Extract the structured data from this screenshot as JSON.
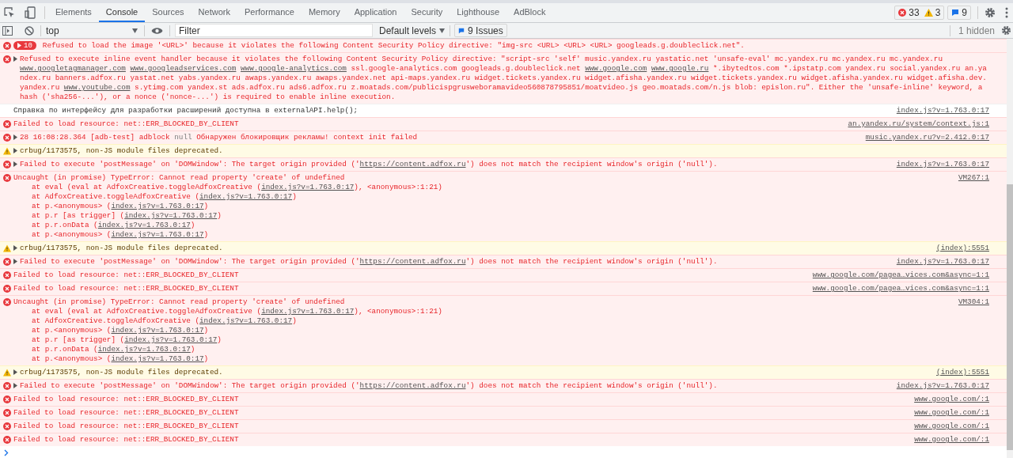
{
  "tabs": [
    {
      "label": "Elements",
      "selected": false
    },
    {
      "label": "Console",
      "selected": true
    },
    {
      "label": "Sources",
      "selected": false
    },
    {
      "label": "Network",
      "selected": false
    },
    {
      "label": "Performance",
      "selected": false
    },
    {
      "label": "Memory",
      "selected": false
    },
    {
      "label": "Application",
      "selected": false
    },
    {
      "label": "Security",
      "selected": false
    },
    {
      "label": "Lighthouse",
      "selected": false
    },
    {
      "label": "AdBlock",
      "selected": false
    }
  ],
  "counters": {
    "errors": "33",
    "warnings": "3",
    "issues": "9"
  },
  "toolbar": {
    "context": "top",
    "filter": {
      "placeholder": "Filter"
    },
    "levels": "Default levels",
    "issues_button": "9 Issues",
    "hidden": "1 hidden"
  },
  "messages": [
    {
      "kind": "error",
      "count": "10",
      "expander": false,
      "text": "Refused to load the image '<URL>' because it violates the following Content Security Policy directive: \"img-src <URL> <URL> <URL> googleads.g.doubleclick.net\"."
    },
    {
      "kind": "error",
      "expander": true,
      "parts": [
        {
          "kind": "text",
          "text": "Refused to execute inline event handler because it violates the following Content Security Policy directive: \"script-src 'self' music.yandex.ru yastatic.net 'unsafe-eval' mc.yandex.ru mc.yandex.ru mc.yandex.ru "
        },
        {
          "kind": "link",
          "text": "www.googletagmanager.com"
        },
        {
          "kind": "link",
          "text": "www.googleadservices.com"
        },
        {
          "kind": "link",
          "text": "www.google-analytics.com"
        },
        {
          "kind": "text",
          "text": " ssl.google-analytics.com googleads.g.doubleclick.net "
        },
        {
          "kind": "link",
          "text": "www.google.com"
        },
        {
          "kind": "link",
          "text": "www.google.ru"
        },
        {
          "kind": "text",
          "text": " *.ibytedtos.com *.ipstatp.com yandex.ru social.yandex.ru an.yandex.ru banners.adfox.ru yastat.net yabs.yandex.ru awaps.yandex.ru awaps.yandex.net api-maps.yandex.ru widget.tickets.yandex.ru widget.afisha.yandex.ru widget.tickets.yandex.ru widget.afisha.yandex.ru widget.afisha.dev.yandex.ru "
        },
        {
          "kind": "link",
          "text": "www.youtube.com"
        },
        {
          "kind": "text",
          "text": " s.ytimg.com yandex.st ads.adfox.ru ads6.adfox.ru z.moatads.com/publicispgrusweboramavideo560878795851/moatvideo.js geo.moatads.com/n.js blob: epislon.ru\". Either the 'unsafe-inline' keyword, a hash ('sha256-...'), or a nonce ('nonce-...') is required to enable inline execution."
        }
      ]
    },
    {
      "kind": "info",
      "expander": false,
      "text": "Справка по интерфейсу для разработки расширений доступна в externalAPI.help();",
      "source": "index.js?v=1.763.0:17"
    },
    {
      "kind": "error",
      "expander": false,
      "text": "Failed to load resource: net::ERR_BLOCKED_BY_CLIENT",
      "source": "an.yandex.ru/system/context.js:1"
    },
    {
      "kind": "error",
      "expander": true,
      "parts": [
        {
          "kind": "text",
          "text": "28 16:08:28.364 [adb-test] adblock "
        },
        {
          "kind": "muted",
          "text": "null"
        },
        {
          "kind": "text",
          "text": " Обнаружен блокировщик рекламы! context init failed"
        }
      ],
      "source": "music.yandex.ru?v=2.412.0:17"
    },
    {
      "kind": "warning",
      "expander": true,
      "text": "crbug/1173575, non-JS module files deprecated."
    },
    {
      "kind": "error",
      "expander": true,
      "parts": [
        {
          "kind": "text",
          "text": "Failed to execute 'postMessage' on 'DOMWindow': The target origin provided ('"
        },
        {
          "kind": "link",
          "text": "https://content.adfox.ru"
        },
        {
          "kind": "text",
          "text": "') does not match the recipient window's origin ('null')."
        }
      ],
      "source": "index.js?v=1.763.0:17"
    },
    {
      "kind": "error",
      "expander": false,
      "text": "Uncaught (in promise) TypeError: Cannot read property 'create' of undefined",
      "source": "VM267:1",
      "stack": [
        {
          "parts": [
            {
              "kind": "text",
              "text": "at eval (eval at AdfoxCreative.toggleAdfoxCreative ("
            },
            {
              "kind": "link",
              "text": "index.js?v=1.763.0:17"
            },
            {
              "kind": "text",
              "text": "), <anonymous>:1:21)"
            }
          ]
        },
        {
          "parts": [
            {
              "kind": "text",
              "text": "at AdfoxCreative.toggleAdfoxCreative ("
            },
            {
              "kind": "link",
              "text": "index.js?v=1.763.0:17"
            },
            {
              "kind": "text",
              "text": ")"
            }
          ]
        },
        {
          "parts": [
            {
              "kind": "text",
              "text": "at p.<anonymous> ("
            },
            {
              "kind": "link",
              "text": "index.js?v=1.763.0:17"
            },
            {
              "kind": "text",
              "text": ")"
            }
          ]
        },
        {
          "parts": [
            {
              "kind": "text",
              "text": "at p.r [as trigger] ("
            },
            {
              "kind": "link",
              "text": "index.js?v=1.763.0:17"
            },
            {
              "kind": "text",
              "text": ")"
            }
          ]
        },
        {
          "parts": [
            {
              "kind": "text",
              "text": "at p.r.onData ("
            },
            {
              "kind": "link",
              "text": "index.js?v=1.763.0:17"
            },
            {
              "kind": "text",
              "text": ")"
            }
          ]
        },
        {
          "parts": [
            {
              "kind": "text",
              "text": "at p.<anonymous> ("
            },
            {
              "kind": "link",
              "text": "index.js?v=1.763.0:17"
            },
            {
              "kind": "text",
              "text": ")"
            }
          ]
        }
      ]
    },
    {
      "kind": "warning",
      "expander": true,
      "text": "crbug/1173575, non-JS module files deprecated.",
      "source": "(index):5551"
    },
    {
      "kind": "error",
      "expander": true,
      "parts": [
        {
          "kind": "text",
          "text": "Failed to execute 'postMessage' on 'DOMWindow': The target origin provided ('"
        },
        {
          "kind": "link",
          "text": "https://content.adfox.ru"
        },
        {
          "kind": "text",
          "text": "') does not match the recipient window's origin ('null')."
        }
      ],
      "source": "index.js?v=1.763.0:17"
    },
    {
      "kind": "error",
      "expander": false,
      "text": "Failed to load resource: net::ERR_BLOCKED_BY_CLIENT",
      "source": "www.google.com/pagea…vices.com&async=1:1"
    },
    {
      "kind": "error",
      "expander": false,
      "text": "Failed to load resource: net::ERR_BLOCKED_BY_CLIENT",
      "source": "www.google.com/pagea…vices.com&async=1:1"
    },
    {
      "kind": "error",
      "expander": false,
      "text": "Uncaught (in promise) TypeError: Cannot read property 'create' of undefined",
      "source": "VM304:1",
      "stack": [
        {
          "parts": [
            {
              "kind": "text",
              "text": "at eval (eval at AdfoxCreative.toggleAdfoxCreative ("
            },
            {
              "kind": "link",
              "text": "index.js?v=1.763.0:17"
            },
            {
              "kind": "text",
              "text": "), <anonymous>:1:21)"
            }
          ]
        },
        {
          "parts": [
            {
              "kind": "text",
              "text": "at AdfoxCreative.toggleAdfoxCreative ("
            },
            {
              "kind": "link",
              "text": "index.js?v=1.763.0:17"
            },
            {
              "kind": "text",
              "text": ")"
            }
          ]
        },
        {
          "parts": [
            {
              "kind": "text",
              "text": "at p.<anonymous> ("
            },
            {
              "kind": "link",
              "text": "index.js?v=1.763.0:17"
            },
            {
              "kind": "text",
              "text": ")"
            }
          ]
        },
        {
          "parts": [
            {
              "kind": "text",
              "text": "at p.r [as trigger] ("
            },
            {
              "kind": "link",
              "text": "index.js?v=1.763.0:17"
            },
            {
              "kind": "text",
              "text": ")"
            }
          ]
        },
        {
          "parts": [
            {
              "kind": "text",
              "text": "at p.r.onData ("
            },
            {
              "kind": "link",
              "text": "index.js?v=1.763.0:17"
            },
            {
              "kind": "text",
              "text": ")"
            }
          ]
        },
        {
          "parts": [
            {
              "kind": "text",
              "text": "at p.<anonymous> ("
            },
            {
              "kind": "link",
              "text": "index.js?v=1.763.0:17"
            },
            {
              "kind": "text",
              "text": ")"
            }
          ]
        }
      ]
    },
    {
      "kind": "warning",
      "expander": true,
      "text": "crbug/1173575, non-JS module files deprecated.",
      "source": "(index):5551"
    },
    {
      "kind": "error",
      "expander": true,
      "parts": [
        {
          "kind": "text",
          "text": "Failed to execute 'postMessage' on 'DOMWindow': The target origin provided ('"
        },
        {
          "kind": "link",
          "text": "https://content.adfox.ru"
        },
        {
          "kind": "text",
          "text": "') does not match the recipient window's origin ('null')."
        }
      ],
      "source": "index.js?v=1.763.0:17"
    },
    {
      "kind": "error",
      "expander": false,
      "text": "Failed to load resource: net::ERR_BLOCKED_BY_CLIENT",
      "source": "www.google.com/:1"
    },
    {
      "kind": "error",
      "expander": false,
      "text": "Failed to load resource: net::ERR_BLOCKED_BY_CLIENT",
      "source": "www.google.com/:1"
    },
    {
      "kind": "error",
      "expander": false,
      "text": "Failed to load resource: net::ERR_BLOCKED_BY_CLIENT",
      "source": "www.google.com/:1"
    },
    {
      "kind": "error",
      "expander": false,
      "text": "Failed to load resource: net::ERR_BLOCKED_BY_CLIENT",
      "source": "www.google.com/:1"
    }
  ]
}
